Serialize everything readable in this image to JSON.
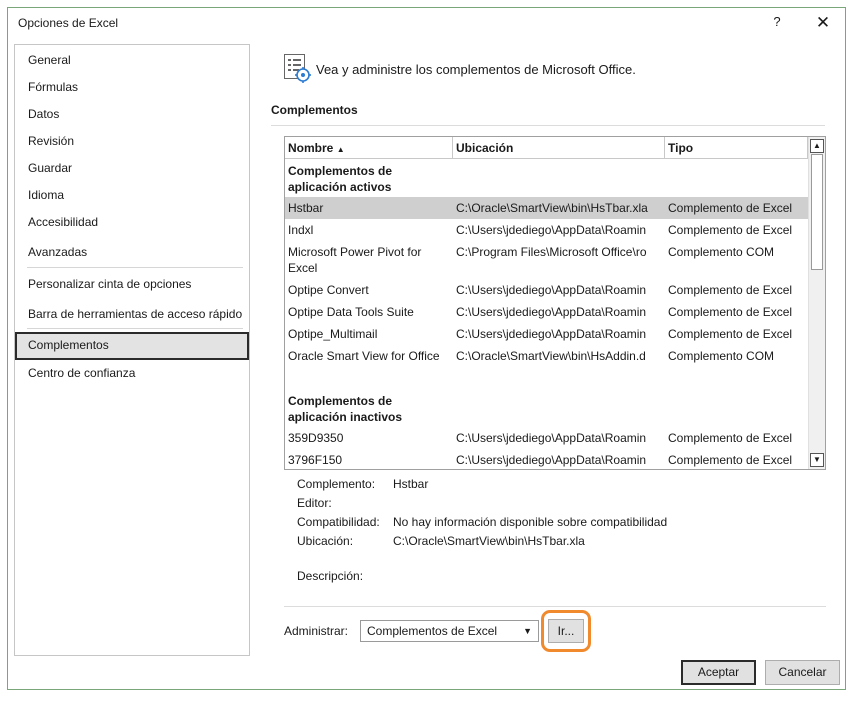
{
  "window": {
    "title": "Opciones de Excel",
    "help": "?",
    "close": "✕"
  },
  "nav": [
    {
      "label": "General"
    },
    {
      "label": "Fórmulas"
    },
    {
      "label": "Datos"
    },
    {
      "label": "Revisión"
    },
    {
      "label": "Guardar"
    },
    {
      "label": "Idioma"
    },
    {
      "label": "Accesibilidad"
    },
    {
      "label": "Avanzadas"
    },
    {
      "label": "Personalizar cinta de opciones"
    },
    {
      "label": "Barra de herramientas de acceso rápido"
    },
    {
      "label": "Complementos"
    },
    {
      "label": "Centro de confianza"
    }
  ],
  "header": {
    "icon": "addins-gear-icon",
    "text": "Vea y administre los complementos de Microsoft Office."
  },
  "section_title": "Complementos",
  "columns": {
    "name": "Nombre",
    "location": "Ubicación",
    "type": "Tipo"
  },
  "groups": {
    "active": [
      "Complementos de",
      "aplicación activos"
    ],
    "inactive": [
      "Complementos de",
      "aplicación inactivos"
    ]
  },
  "active": [
    {
      "name": "Hstbar",
      "location": "C:\\Oracle\\SmartView\\bin\\HsTbar.xla",
      "type": "Complemento de Excel"
    },
    {
      "name": "Indxl",
      "location": "C:\\Users\\jdediego\\AppData\\Roamin",
      "type": "Complemento de Excel"
    },
    {
      "name": "Microsoft Power Pivot for",
      "name2": "Excel",
      "location": "C:\\Program Files\\Microsoft Office\\ro",
      "type": "Complemento COM"
    },
    {
      "name": "Optipe Convert",
      "location": "C:\\Users\\jdediego\\AppData\\Roamin",
      "type": "Complemento de Excel"
    },
    {
      "name": "Optipe Data Tools Suite",
      "location": "C:\\Users\\jdediego\\AppData\\Roamin",
      "type": "Complemento de Excel"
    },
    {
      "name": "Optipe_Multimail",
      "location": "C:\\Users\\jdediego\\AppData\\Roamin",
      "type": "Complemento de Excel"
    },
    {
      "name": "Oracle Smart View for Office",
      "location": "C:\\Oracle\\SmartView\\bin\\HsAddin.d",
      "type": "Complemento COM"
    }
  ],
  "inactive": [
    {
      "name": "359D9350",
      "location": "C:\\Users\\jdediego\\AppData\\Roamin",
      "type": "Complemento de Excel"
    },
    {
      "name": "3796F150",
      "location": "C:\\Users\\jdediego\\AppData\\Roamin",
      "type": "Complemento de Excel"
    }
  ],
  "details": {
    "addin_label": "Complemento:",
    "addin_value": "Hstbar",
    "editor_label": "Editor:",
    "compat_label": "Compatibilidad:",
    "compat_value": "No hay información disponible sobre compatibilidad",
    "location_label": "Ubicación:",
    "location_value": "C:\\Oracle\\SmartView\\bin\\HsTbar.xla",
    "desc_label": "Descripción:"
  },
  "manage": {
    "label": "Administrar:",
    "selected": "Complementos de Excel",
    "go": "Ir..."
  },
  "buttons": {
    "ok": "Aceptar",
    "cancel": "Cancelar"
  },
  "colors": {
    "highlight": "#f08a2c",
    "frame": "#7aa77a"
  }
}
